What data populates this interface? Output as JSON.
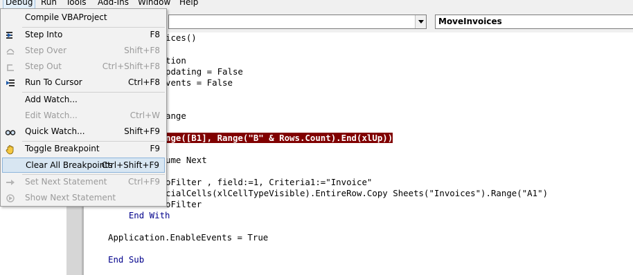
{
  "menubar": [
    {
      "label": "Debug",
      "active": true
    },
    {
      "label": "Run"
    },
    {
      "label": "Tools"
    },
    {
      "label": "Add-Ins"
    },
    {
      "label": "Window"
    },
    {
      "label": "Help"
    }
  ],
  "toolbar": {
    "object_combo": "",
    "procedure_combo": "MoveInvoices"
  },
  "debug_menu": [
    {
      "label": "Compile VBAProject",
      "shortcut": "",
      "enabled": true,
      "icon": "none"
    },
    {
      "label": "Step Into",
      "shortcut": "F8",
      "enabled": true,
      "icon": "step-into-icon"
    },
    {
      "label": "Step Over",
      "shortcut": "Shift+F8",
      "enabled": false,
      "icon": "step-over-icon"
    },
    {
      "label": "Step Out",
      "shortcut": "Ctrl+Shift+F8",
      "enabled": false,
      "icon": "step-out-icon"
    },
    {
      "label": "Run To Cursor",
      "shortcut": "Ctrl+F8",
      "enabled": true,
      "icon": "run-to-cursor-icon"
    },
    {
      "label": "Add Watch...",
      "shortcut": "",
      "enabled": true,
      "icon": "none"
    },
    {
      "label": "Edit Watch...",
      "shortcut": "Ctrl+W",
      "enabled": false,
      "icon": "none"
    },
    {
      "label": "Quick Watch...",
      "shortcut": "Shift+F9",
      "enabled": true,
      "icon": "glasses-icon"
    },
    {
      "label": "Toggle Breakpoint",
      "shortcut": "F9",
      "enabled": true,
      "icon": "hand-icon"
    },
    {
      "label": "Clear All Breakpoints",
      "shortcut": "Ctrl+Shift+F9",
      "enabled": true,
      "icon": "none",
      "highlighted": true
    },
    {
      "label": "Set Next Statement",
      "shortcut": "Ctrl+F9",
      "enabled": false,
      "icon": "arrow-right-icon"
    },
    {
      "label": "Show Next Statement",
      "shortcut": "",
      "enabled": false,
      "icon": "show-next-icon"
    }
  ],
  "code": {
    "lines": [
      "ices()",
      "",
      "tion",
      "pdating = False",
      "vents = False",
      "",
      "",
      "ange",
      "",
      "nge([B1], Range(\"B\" & Rows.Count).End(xlUp))",
      "",
      "ume Next",
      "",
      "oFilter , field:=1, Criteria1:=\"Invoice\"",
      "cialCells(xlCellTypeVisible).EntireRow.Copy Sheets(\"Invoices\").Range(\"A1\")",
      "oFilter",
      "    End With",
      "",
      "Application.EnableEvents = True",
      "",
      "End Sub"
    ]
  }
}
